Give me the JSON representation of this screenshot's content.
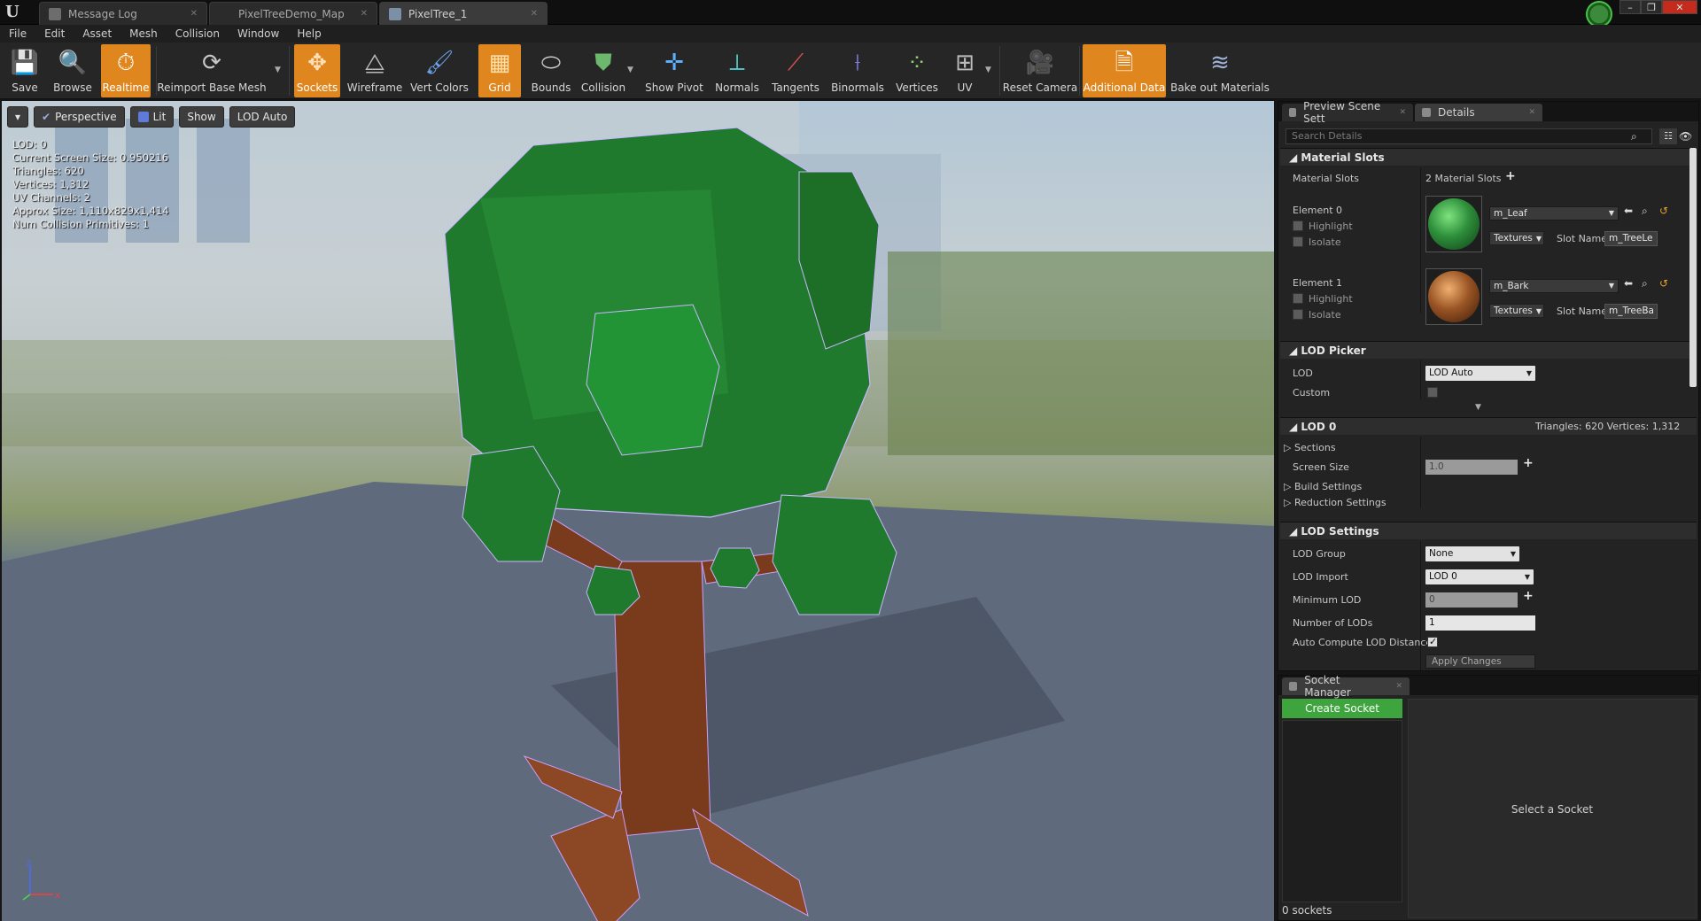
{
  "tabs": [
    {
      "label": "Message Log"
    },
    {
      "label": "PixelTreeDemo_Map"
    },
    {
      "label": "PixelTree_1"
    }
  ],
  "menu": [
    "File",
    "Edit",
    "Asset",
    "Mesh",
    "Collision",
    "Window",
    "Help"
  ],
  "toolbar": {
    "save": "Save",
    "browse": "Browse",
    "realtime": "Realtime",
    "reimport": "Reimport Base Mesh",
    "sockets": "Sockets",
    "wireframe": "Wireframe",
    "vert_colors": "Vert Colors",
    "grid": "Grid",
    "bounds": "Bounds",
    "collision": "Collision",
    "show_pivot": "Show Pivot",
    "normals": "Normals",
    "tangents": "Tangents",
    "binormals": "Binormals",
    "vertices": "Vertices",
    "uv": "UV",
    "reset_camera": "Reset Camera",
    "additional_data": "Additional Data",
    "bake_materials": "Bake out Materials"
  },
  "viewport": {
    "perspective": "Perspective",
    "lit": "Lit",
    "show": "Show",
    "lod_auto": "LOD Auto",
    "stats": [
      "LOD:  0",
      "Current Screen Size:  0.950216",
      "Triangles:  620",
      "Vertices:  1,312",
      "UV Channels:  2",
      "Approx Size: 1,110x829x1,414",
      "Num Collision Primitives:  1"
    ],
    "axis_z": "z",
    "axis_x": "x"
  },
  "details": {
    "tab_preview": "Preview Scene Sett",
    "tab_details": "Details",
    "search_placeholder": "Search Details",
    "material_slots": {
      "header": "Material Slots",
      "label": "Material Slots",
      "count": "2 Material Slots",
      "elements": [
        {
          "label": "Element 0",
          "highlight": "Highlight",
          "isolate": "Isolate",
          "material": "m_Leaf",
          "textures": "Textures",
          "slot_label": "Slot Name",
          "slot_value": "m_TreeLe",
          "color": "#2e8f3b"
        },
        {
          "label": "Element 1",
          "highlight": "Highlight",
          "isolate": "Isolate",
          "material": "m_Bark",
          "textures": "Textures",
          "slot_label": "Slot Name",
          "slot_value": "m_TreeBa",
          "color": "#9a5525"
        }
      ]
    },
    "lod_picker": {
      "header": "LOD Picker",
      "lod_label": "LOD",
      "lod_value": "LOD Auto",
      "custom_label": "Custom"
    },
    "lod0": {
      "header": "LOD 0",
      "stats": "Triangles: 620   Vertices: 1,312",
      "sections": "Sections",
      "screen_size_label": "Screen Size",
      "screen_size_value": "1.0",
      "build_settings": "Build Settings",
      "reduction_settings": "Reduction Settings"
    },
    "lod_settings": {
      "header": "LOD Settings",
      "lod_group_label": "LOD Group",
      "lod_group_value": "None",
      "lod_import_label": "LOD Import",
      "lod_import_value": "LOD 0",
      "min_lod_label": "Minimum LOD",
      "min_lod_value": "0",
      "num_lods_label": "Number of LODs",
      "num_lods_value": "1",
      "auto_compute_label": "Auto Compute LOD Distance",
      "apply_changes": "Apply Changes"
    }
  },
  "socket_manager": {
    "tab": "Socket Manager",
    "create_socket": "Create Socket",
    "placeholder": "Select a Socket",
    "count": "0 sockets"
  }
}
